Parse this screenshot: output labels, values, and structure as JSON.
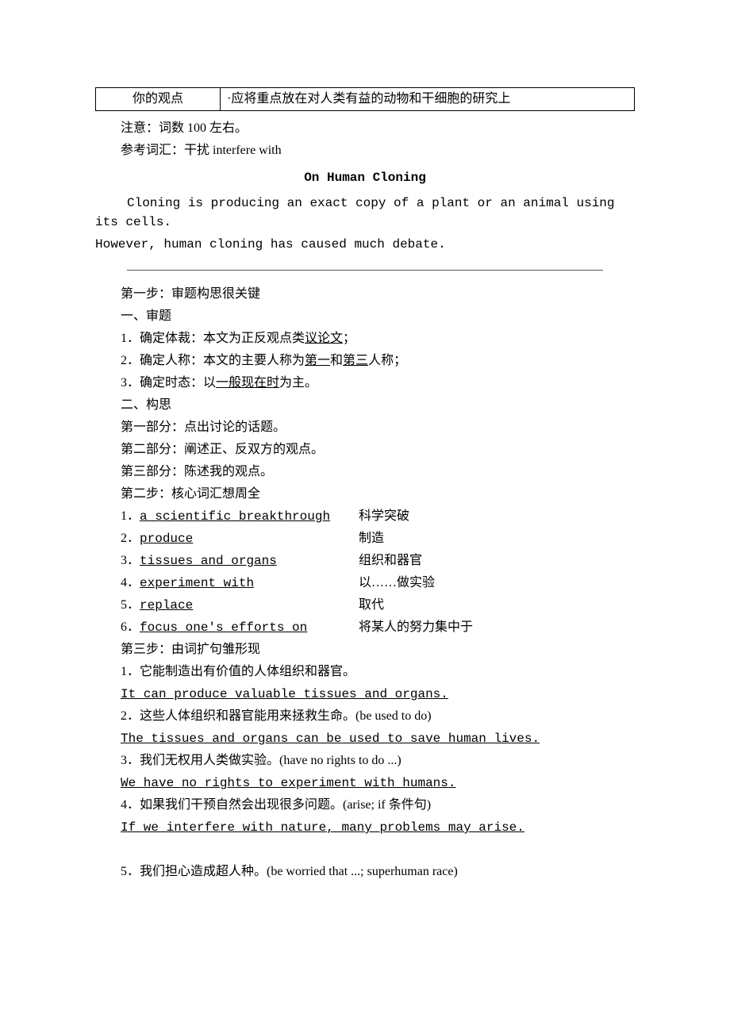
{
  "table": {
    "label": "你的观点",
    "value": "·应将重点放在对人类有益的动物和干细胞的研究上"
  },
  "notes": {
    "count_note": "注意：词数 100 左右。",
    "ref_vocab": "参考词汇：干扰 interfere with"
  },
  "essay": {
    "title": "On Human Cloning",
    "line1": "Cloning is producing an exact copy of a plant or an animal using its cells.",
    "line2": "However, human cloning has caused much debate."
  },
  "step1": {
    "heading": "第一步：审题构思很关键",
    "sub_a": "一、审题",
    "items_a": {
      "i1_pre": "1．确定体裁：本文为正反观点类",
      "i1_u": "议论文",
      "i1_post": "；",
      "i2_pre": "2．确定人称：本文的主要人称为",
      "i2_u1": "第一",
      "i2_mid": "和",
      "i2_u2": "第三",
      "i2_post": "人称；",
      "i3_pre": "3．确定时态：以",
      "i3_u": "一般现在时",
      "i3_post": "为主。"
    },
    "sub_b": "二、构思",
    "items_b": {
      "b1": "第一部分：点出讨论的话题。",
      "b2": "第二部分：阐述正、反双方的观点。",
      "b3": "第三部分：陈述我的观点。"
    }
  },
  "step2": {
    "heading": "第二步：核心词汇想周全",
    "vocab": [
      {
        "num": "1．",
        "en": "a scientific breakthrough",
        "zh": "科学突破"
      },
      {
        "num": "2．",
        "en": "produce",
        "zh": "制造"
      },
      {
        "num": "3．",
        "en": "tissues and organs",
        "zh": "组织和器官"
      },
      {
        "num": "4．",
        "en": "experiment with",
        "zh": "以……做实验"
      },
      {
        "num": "5．",
        "en": "replace",
        "zh": "取代"
      },
      {
        "num": "6．",
        "en": "focus one's efforts on",
        "zh": "将某人的努力集中于"
      }
    ]
  },
  "step3": {
    "heading": "第三步：由词扩句雏形现",
    "items": [
      {
        "cn": "1．它能制造出有价值的人体组织和器官。",
        "en": "It can produce valuable tissues and organs."
      },
      {
        "cn": "2．这些人体组织和器官能用来拯救生命。(be used to do)",
        "en": "The tissues and organs can be used to save human lives."
      },
      {
        "cn": "3．我们无权用人类做实验。(have no rights to do ...)",
        "en": "We have no rights to experiment with humans."
      },
      {
        "cn": "4．如果我们干预自然会出现很多问题。(arise; if 条件句)",
        "en": "If we interfere with nature, many problems may arise."
      }
    ],
    "last_cn": "5．我们担心造成超人种。(be worried that ...; superhuman race)"
  }
}
